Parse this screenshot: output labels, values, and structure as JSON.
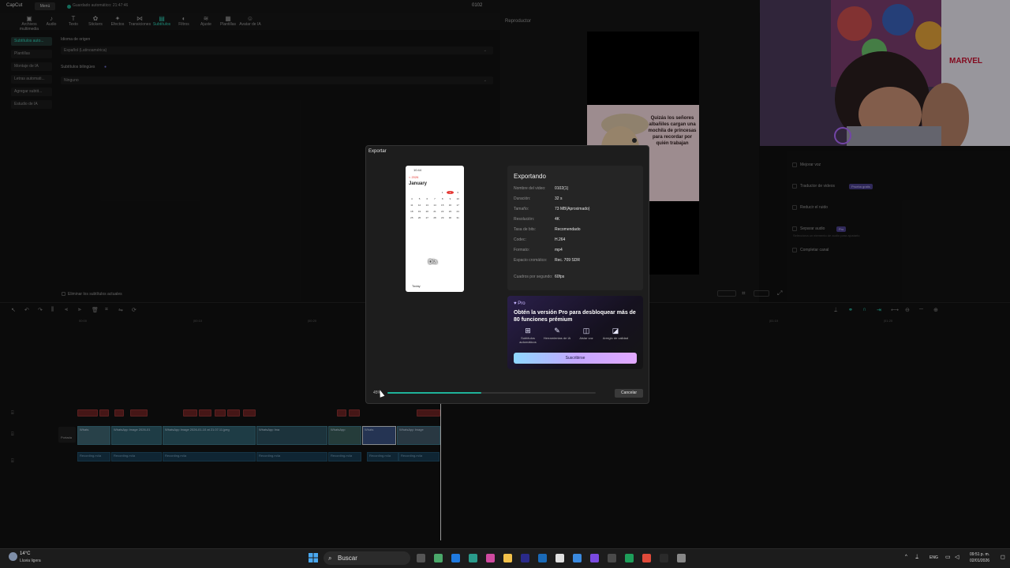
{
  "titlebar": {
    "app_name": "CapCut",
    "menu_label": "Menú",
    "autosave": "Guardado automático: 21:47:46",
    "project_name": "0102"
  },
  "toolbar": {
    "tools": [
      {
        "label": "Archivos multimedia",
        "icon": "media-icon"
      },
      {
        "label": "Audio",
        "icon": "audio-icon"
      },
      {
        "label": "Texto",
        "icon": "text-icon"
      },
      {
        "label": "Stickers",
        "icon": "sticker-icon"
      },
      {
        "label": "Efectos",
        "icon": "effects-icon"
      },
      {
        "label": "Transiciones",
        "icon": "transitions-icon"
      },
      {
        "label": "Subtítulos",
        "icon": "captions-icon",
        "active": true
      },
      {
        "label": "Filtros",
        "icon": "filters-icon"
      },
      {
        "label": "Ajuste",
        "icon": "adjust-icon"
      },
      {
        "label": "Plantillas",
        "icon": "templates-icon"
      },
      {
        "label": "Avatar de IA",
        "icon": "ai-avatar-icon"
      }
    ]
  },
  "left_sidebar": {
    "items": [
      "Subtítulos auto...",
      "Plantillas",
      "Montaje de IA",
      "Letras automati...",
      "Agregar subtit...",
      "Estudio de IA"
    ]
  },
  "caption_settings": {
    "source_language_label": "Idioma de origen",
    "source_language_value": "Español (Latinoamérica)",
    "bilingual_label": "Subtítulos bilingües",
    "bilingual_value": "Ninguno",
    "clear_label": "Eliminar los subtítulos actuales"
  },
  "player": {
    "title": "Reproductor",
    "caption_text": "Quizás los señores albañiles cargan una mochila de princesas para recordar por quién trabajan"
  },
  "right_panel": {
    "items": [
      {
        "label": "Mejorar voz"
      },
      {
        "label": "Traductor de videos",
        "badge": "Prueba gratis"
      },
      {
        "label": "Reducir el ruido"
      },
      {
        "label": "Separar audio",
        "badge": "Pro",
        "hint": "Selecciona un elemento de audio para ajustarlo"
      },
      {
        "label": "Completar canal"
      }
    ]
  },
  "export_dialog": {
    "title": "Exportar",
    "status_heading": "Exportando",
    "details": [
      {
        "key": "Nombre del video:",
        "value": "0102(1)"
      },
      {
        "key": "Duración:",
        "value": "32 s"
      },
      {
        "key": "Tamaño:",
        "value": "73 MB(Aproximado)"
      },
      {
        "key": "Resolución:",
        "value": "4K"
      },
      {
        "key": "Tasa de bits:",
        "value": "Recomendado"
      },
      {
        "key": "Codec:",
        "value": "H.264"
      },
      {
        "key": "Formato:",
        "value": "mp4"
      },
      {
        "key": "Espacio cromático:",
        "value": "Rec. 709 SDR"
      },
      {
        "key": "Cuadros por segundo:",
        "value": "60fps"
      }
    ],
    "preview": {
      "month": "January",
      "back_label": "< 2026",
      "status_time": "10:44",
      "caption": "Día",
      "today_label": "Today",
      "days": [
        "",
        "",
        "",
        "",
        "1",
        "2",
        "3",
        "4",
        "5",
        "6",
        "7",
        "8",
        "9",
        "10",
        "11",
        "12",
        "13",
        "14",
        "15",
        "16",
        "17",
        "18",
        "19",
        "20",
        "21",
        "22",
        "23",
        "24",
        "25",
        "26",
        "27",
        "28",
        "29",
        "30",
        "31"
      ]
    },
    "pro": {
      "tag": "Pro",
      "headline": "Obtén la versión Pro para desbloquear más de 80 funciones prémium",
      "features": [
        {
          "label": "Subtítulos automáticos",
          "icon": "captions-grid-icon"
        },
        {
          "label": "Herramientas de IA",
          "icon": "ai-tools-icon"
        },
        {
          "label": "Aislar voz",
          "icon": "voice-isolate-icon"
        },
        {
          "label": "Arreglo de calidad",
          "icon": "quality-icon"
        }
      ],
      "subscribe_label": "Suscribirse"
    },
    "progress_percent": "45%",
    "progress_value": 0.45,
    "cancel_label": "Cancelar"
  },
  "timeline": {
    "cover_label": "Portada",
    "video_clips": [
      "Whats",
      "WhatsApp Image 2026-01",
      "WhatsApp Image 2026-01-10 at 21.07.11.jpeg",
      "WhatsApp Ima",
      "WhatsApp",
      "Whats",
      "WhatsApp Image",
      "WhatsApp Ima"
    ],
    "audio_clips": [
      "Recording.m4a",
      "Recording.m4a",
      "Recording.m4a",
      "Recording.m4a",
      "Recording.m4a",
      "Recording.m4a",
      "Recording.m4a"
    ],
    "ruler": [
      "00:00",
      "|00:10",
      "|00:20",
      "|00:30",
      "|00:40",
      "|01:10",
      "|01:20"
    ]
  },
  "taskbar": {
    "weather_temp": "14°C",
    "weather_desc": "Lluvia ligera",
    "search_placeholder": "Buscar",
    "language": "ENG",
    "time": "09:51 p. m.",
    "date": "02/01/2026"
  },
  "colors": {
    "accent": "#2fd0b5",
    "progress": "#1fb39a",
    "today": "#e53935"
  }
}
